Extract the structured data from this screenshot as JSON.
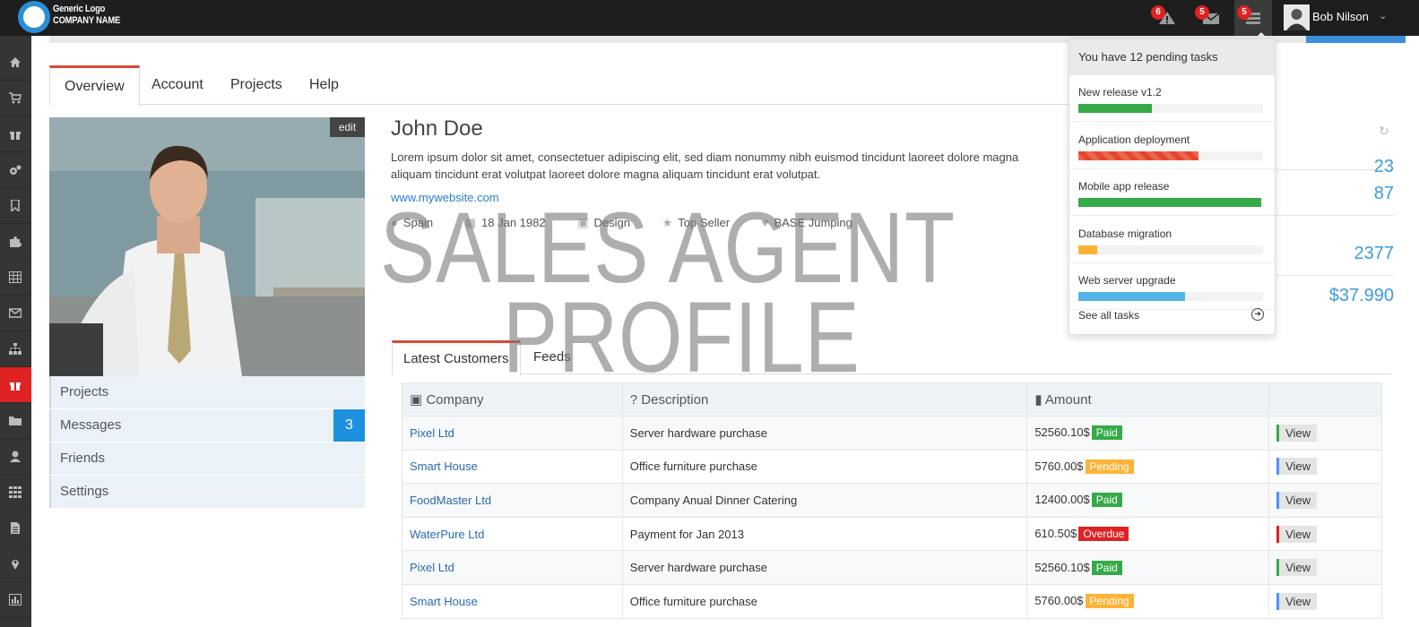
{
  "header": {
    "logo_line1": "Generic Logo",
    "logo_line2": "COMPANY NAME",
    "notifications": [
      {
        "icon": "warning-icon",
        "count": "6"
      },
      {
        "icon": "envelope-icon",
        "count": "5"
      },
      {
        "icon": "tasks-icon",
        "count": "5"
      }
    ],
    "user_name": "Bob Nilson"
  },
  "sidebar": {
    "icons": [
      "home-icon",
      "cart-icon",
      "gift-icon",
      "cogs-icon",
      "bookmark-icon",
      "puzzle-icon",
      "table-icon",
      "envelope-icon",
      "sitemap-icon",
      "gift-icon",
      "folder-icon",
      "user-icon",
      "grid-icon",
      "file-icon",
      "map-marker-icon",
      "bar-chart-icon"
    ],
    "active_index": 9
  },
  "tabs": [
    "Overview",
    "Account",
    "Projects",
    "Help"
  ],
  "profile": {
    "edit_label": "edit",
    "menu": [
      {
        "label": "Projects",
        "count": ""
      },
      {
        "label": "Messages",
        "count": "3"
      },
      {
        "label": "Friends",
        "count": ""
      },
      {
        "label": "Settings",
        "count": ""
      }
    ],
    "name": "John Doe",
    "description": "Lorem ipsum dolor sit amet, consectetuer adipiscing elit, sed diam nonummy nibh euismod tincidunt laoreet dolore magna aliquam tincidunt erat volutpat laoreet dolore magna aliquam tincidunt erat volutpat.",
    "website": "www.mywebsite.com",
    "meta": [
      "Spain",
      "18 Jan 1982",
      "Design",
      "Top Seller",
      "BASE Jumping"
    ]
  },
  "watermark": {
    "line1": "SALES AGENT",
    "line2": "PROFILE"
  },
  "stats": [
    "23",
    "87",
    "2377",
    "$37.990"
  ],
  "content_tabs": [
    "Latest Customers",
    "Feeds"
  ],
  "table": {
    "headers": [
      "Company",
      "Description",
      "Amount",
      ""
    ],
    "rows": [
      {
        "company": "Pixel Ltd",
        "description": "Server hardware purchase",
        "amount": "52560.10$",
        "status": "Paid",
        "status_color": "#35aa47",
        "view": "View",
        "view_color": "#35aa47"
      },
      {
        "company": "Smart House",
        "description": "Office furniture purchase",
        "amount": "5760.00$",
        "status": "Pending",
        "status_color": "#ffb336",
        "view": "View",
        "view_color": "#4d90fe"
      },
      {
        "company": "FoodMaster Ltd",
        "description": "Company Anual Dinner Catering",
        "amount": "12400.00$",
        "status": "Paid",
        "status_color": "#35aa47",
        "view": "View",
        "view_color": "#4d90fe"
      },
      {
        "company": "WaterPure Ltd",
        "description": "Payment for Jan 2013",
        "amount": "610.50$",
        "status": "Overdue",
        "status_color": "#e02222",
        "view": "View",
        "view_color": "#e02222"
      },
      {
        "company": "Pixel Ltd",
        "description": "Server hardware purchase",
        "amount": "52560.10$",
        "status": "Paid",
        "status_color": "#35aa47",
        "view": "View",
        "view_color": "#35aa47"
      },
      {
        "company": "Smart House",
        "description": "Office furniture purchase",
        "amount": "5760.00$",
        "status": "Pending",
        "status_color": "#ffb336",
        "view": "View",
        "view_color": "#4d90fe"
      }
    ]
  },
  "tasks_dropdown": {
    "header": "You have 12 pending tasks",
    "items": [
      {
        "title": "New release v1.2",
        "progress": 0.4,
        "color": "#35aa47"
      },
      {
        "title": "Application deployment",
        "progress": 0.65,
        "color": "#e8462a"
      },
      {
        "title": "Mobile app release",
        "progress": 0.99,
        "color": "#35aa47"
      },
      {
        "title": "Database migration",
        "progress": 0.1,
        "color": "#ffb336"
      },
      {
        "title": "Web server upgrade",
        "progress": 0.58,
        "color": "#52b4e8"
      }
    ],
    "footer": "See all tasks"
  },
  "colors": {
    "topbar": "#1e1e1e",
    "sidebar": "#353535",
    "accent_red": "#e02222",
    "link": "#2a7dcf",
    "stat_blue": "#3c9be0"
  }
}
